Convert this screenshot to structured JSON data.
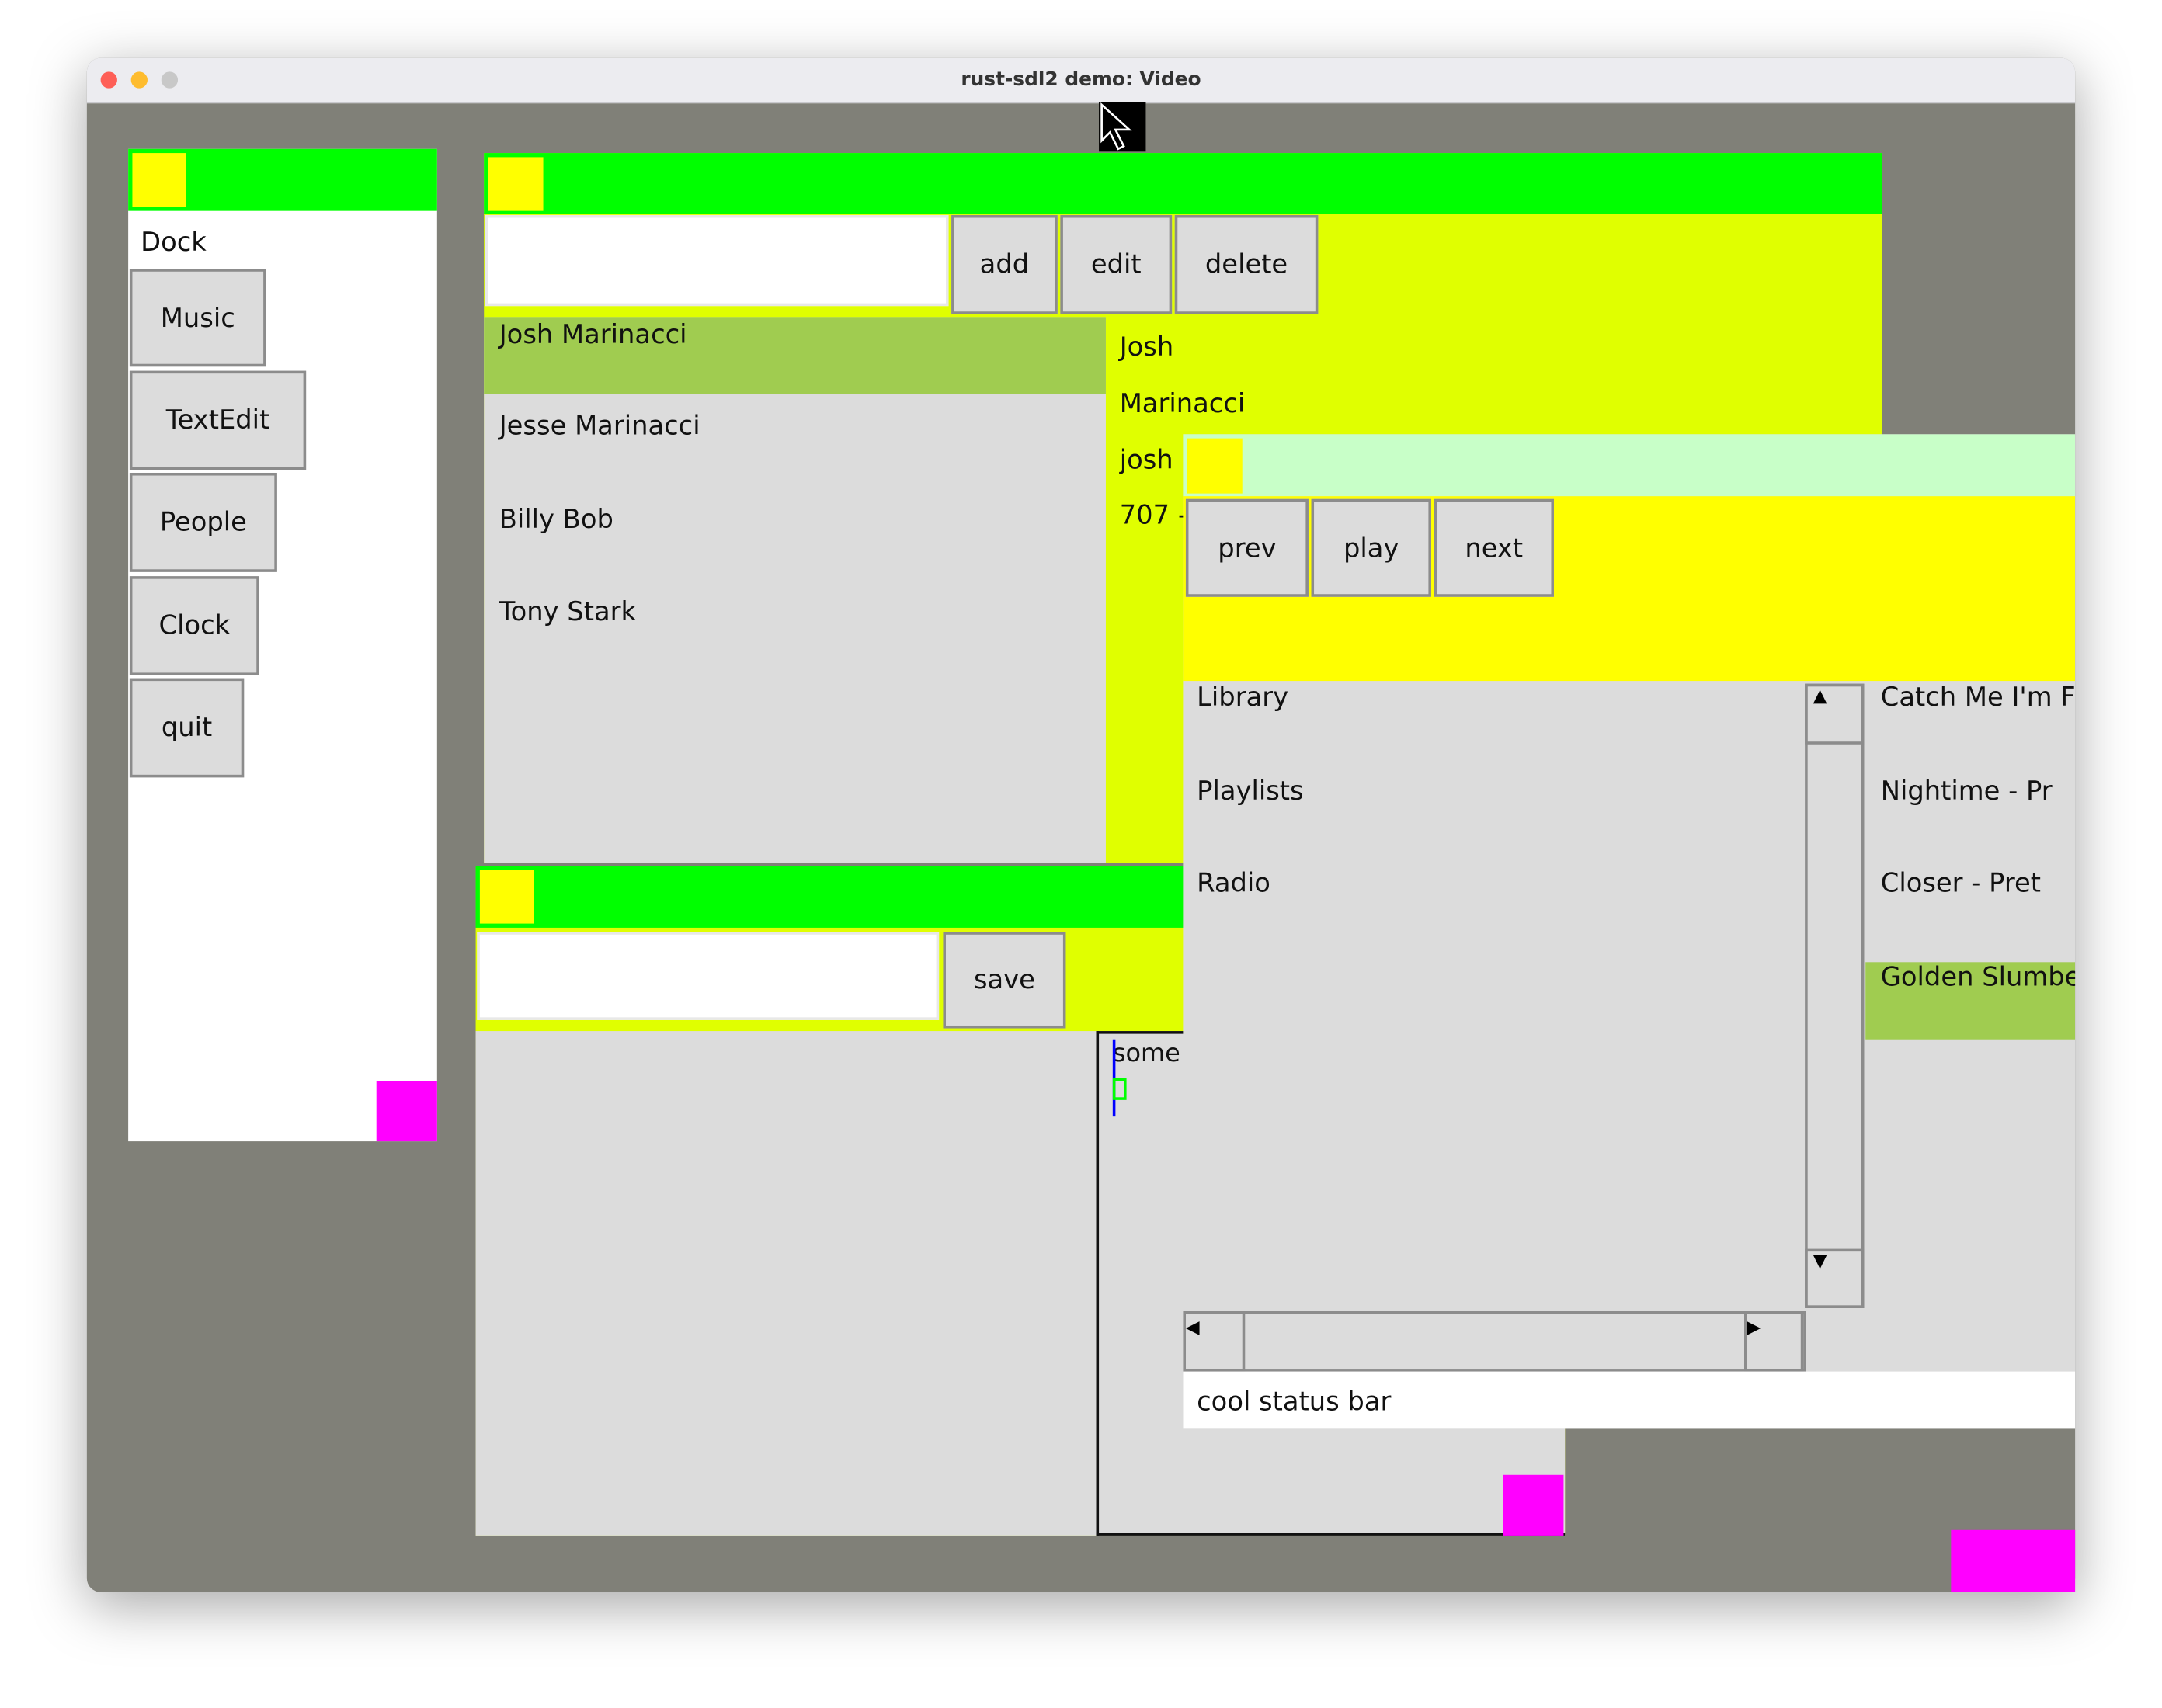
{
  "window": {
    "title": "rust-sdl2 demo: Video"
  },
  "dock": {
    "title": "Dock",
    "buttons": [
      "Music",
      "TextEdit",
      "People",
      "Clock",
      "quit"
    ]
  },
  "people": {
    "search_value": "",
    "buttons": {
      "add": "add",
      "edit": "edit",
      "delete": "delete"
    },
    "list": [
      "Josh Marinacci",
      "Jesse Marinacci",
      "Billy Bob",
      "Tony Stark"
    ],
    "selected_index": 0,
    "details": {
      "first": "Josh",
      "last": "Marinacci",
      "email": "josh",
      "phone": "707 -"
    }
  },
  "textedit": {
    "filename_value": "",
    "save": "save",
    "content": "some"
  },
  "music": {
    "buttons": {
      "prev": "prev",
      "play": "play",
      "next": "next"
    },
    "sources": [
      "Library",
      "Playlists",
      "Radio"
    ],
    "tracks": [
      "Catch Me I'm F",
      "Nightime - Pr",
      "Closer - Pret",
      "Golden Slumbe"
    ],
    "selected_track_index": 3,
    "status": "cool status bar"
  },
  "colors": {
    "titlebar": "#00ff00",
    "panel": "#e0ff00",
    "selected": "#a0cc50",
    "desktop": "#808078",
    "resize": "#ff00ff"
  }
}
